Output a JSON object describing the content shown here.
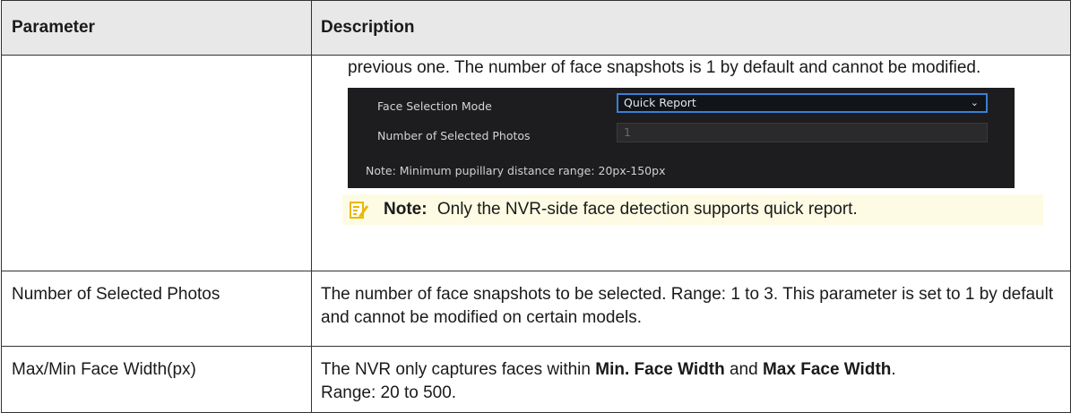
{
  "table": {
    "headers": {
      "parameter": "Parameter",
      "description": "Description"
    },
    "row1": {
      "description_text": "previous one. The number of face snapshots is 1 by default and cannot be modified.",
      "panel": {
        "field1_label": "Face Selection Mode",
        "field1_value": "Quick Report",
        "field2_label": "Number of Selected Photos",
        "field2_value": "1",
        "note": "Note: Minimum pupillary distance range: 20px-150px"
      },
      "note": {
        "label": "Note:",
        "text": "Only the NVR-side face detection supports quick report."
      }
    },
    "row2": {
      "parameter": "Number of Selected Photos",
      "description": "The number of face snapshots to be selected. Range: 1 to 3. This parameter is set to 1 by default and cannot be modified on certain models."
    },
    "row3": {
      "parameter": "Max/Min Face Width(px)",
      "desc_part1": "The NVR only captures faces within ",
      "desc_bold1": "Min. Face Width",
      "desc_part2": " and ",
      "desc_bold2": "Max Face Width",
      "desc_part3": ".",
      "desc_part4": "Range: 20 to 500."
    }
  },
  "colors": {
    "panel_bg": "#1d1d1f",
    "select_border": "#3a7fd5",
    "note_bg": "#fdfbe3",
    "note_icon": "#e8b800"
  },
  "icons": {
    "note": "note-pencil-icon",
    "dropdown": "chevron-down-icon"
  }
}
